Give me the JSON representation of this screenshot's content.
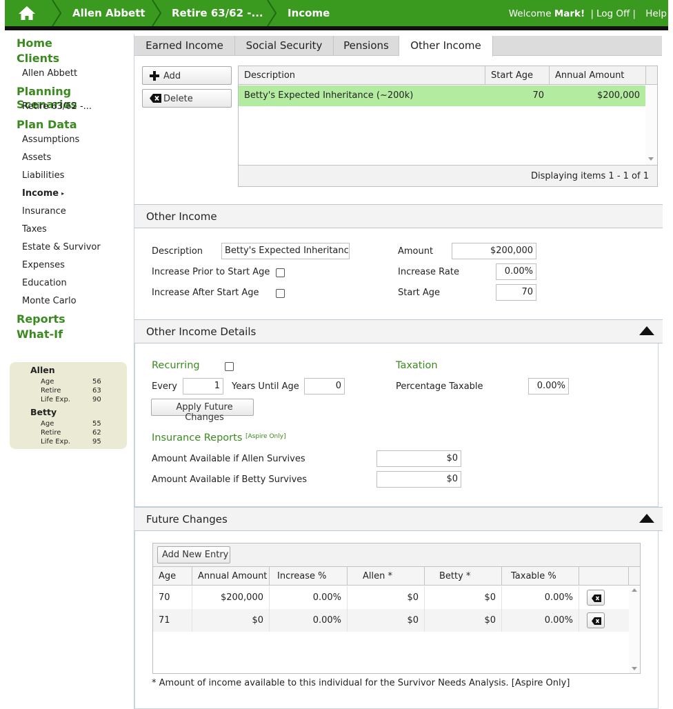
{
  "breadcrumb": {
    "client": "Allen Abbett",
    "scenario": "Retire 63/62 -...",
    "section": "Income"
  },
  "header_right": {
    "welcome_prefix": "Welcome",
    "user": "Mark!",
    "sep": "|",
    "logoff": "Log Off",
    "help": "Help"
  },
  "nav": {
    "home": "Home",
    "clients": "Clients",
    "client_name": "Allen Abbett",
    "planning": "Planning Scenarios",
    "scenario": "Retire 63/62 -...",
    "plan_data": "Plan Data",
    "items": [
      "Assumptions",
      "Assets",
      "Liabilities",
      "Income",
      "Insurance",
      "Taxes",
      "Estate & Survivor",
      "Expenses",
      "Education",
      "Monte Carlo"
    ],
    "active_arrow": "▸",
    "reports": "Reports",
    "whatif": "What-If"
  },
  "ages": {
    "p1": {
      "name": "Allen",
      "age_lbl": "Age",
      "age": "56",
      "retire_lbl": "Retire",
      "retire": "63",
      "life_lbl": "Life Exp.",
      "life": "90"
    },
    "p2": {
      "name": "Betty",
      "age_lbl": "Age",
      "age": "55",
      "retire_lbl": "Retire",
      "retire": "62",
      "life_lbl": "Life Exp.",
      "life": "95"
    }
  },
  "tabs": [
    "Earned Income",
    "Social Security",
    "Pensions",
    "Other Income"
  ],
  "toolbar": {
    "add": "Add",
    "delete": "Delete"
  },
  "grid": {
    "columns": [
      "Description",
      "Start Age",
      "Annual Amount"
    ],
    "rows": [
      {
        "description": "Betty's Expected Inheritance (~200k)",
        "start_age": "70",
        "amount": "$200,000"
      }
    ],
    "footer": "Displaying items 1 - 1 of 1"
  },
  "other_income": {
    "title": "Other Income",
    "description_lbl": "Description",
    "description_val": "Betty's Expected Inheritance (",
    "inc_prior_lbl": "Increase Prior to Start Age",
    "inc_after_lbl": "Increase After Start Age",
    "amount_lbl": "Amount",
    "amount_val": "$200,000",
    "rate_lbl": "Increase Rate",
    "rate_val": "0.00%",
    "start_lbl": "Start Age",
    "start_val": "70"
  },
  "details": {
    "title": "Other Income Details",
    "recurring": "Recurring",
    "every_lbl": "Every",
    "every_val": "1",
    "years_lbl": "Years Until Age",
    "years_val": "0",
    "apply_btn": "Apply Future Changes",
    "taxation": "Taxation",
    "pct_tax_lbl": "Percentage Taxable",
    "pct_tax_val": "0.00%",
    "ins_reports": "Insurance Reports",
    "aspire_tag": "[Aspire Only]",
    "allen_surv_lbl": "Amount Available if Allen Survives",
    "allen_surv_val": "$0",
    "betty_surv_lbl": "Amount Available if Betty Survives",
    "betty_surv_val": "$0"
  },
  "future": {
    "title": "Future Changes",
    "add_btn": "Add New Entry",
    "columns": [
      "Age",
      "Annual Amount",
      "Increase %",
      "Allen *",
      "Betty *",
      "Taxable %"
    ],
    "rows": [
      {
        "age": "70",
        "amount": "$200,000",
        "inc": "0.00%",
        "allen": "$0",
        "betty": "$0",
        "tax": "0.00%"
      },
      {
        "age": "71",
        "amount": "$0",
        "inc": "0.00%",
        "allen": "$0",
        "betty": "$0",
        "tax": "0.00%"
      }
    ],
    "note": "* Amount of income available to this individual for the Survivor Needs Analysis. [Aspire Only]"
  },
  "colors": {
    "brand_green": "#3a9a1f",
    "nav_green": "#3a8a1f",
    "selected_row": "#b3eca0"
  }
}
